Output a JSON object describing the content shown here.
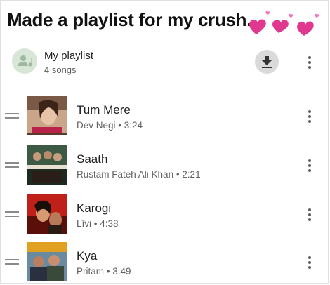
{
  "caption": "Made a playlist for my crush.",
  "playlist": {
    "title": "My playlist",
    "count": "4 songs",
    "download_icon": "download-icon",
    "more_icon": "more-vert-icon"
  },
  "songs": [
    {
      "title": "Tum Mere",
      "subtitle": "Dev Negi • 3:24"
    },
    {
      "title": "Saath",
      "subtitle": "Rustam Fateh Ali Khan • 2:21"
    },
    {
      "title": "Karogi",
      "subtitle": "Līvi • 4:38"
    },
    {
      "title": "Kya",
      "subtitle": "Pritam • 3:49"
    }
  ],
  "colors": {
    "heart": "#e0388f",
    "avatar_bg": "#d7e6d7",
    "avatar_fg": "#9fb89f",
    "download_bg": "#dadada"
  }
}
